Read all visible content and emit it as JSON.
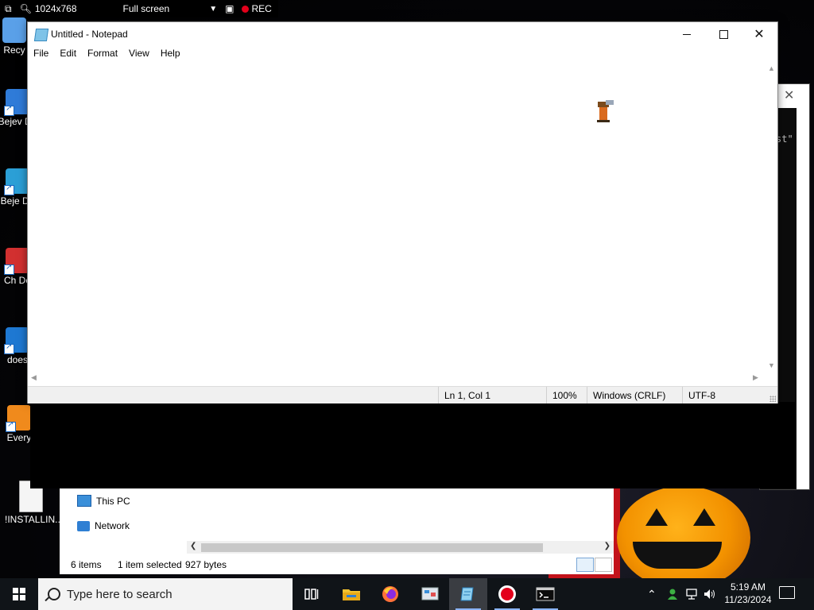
{
  "recorder": {
    "resolution": "1024x768",
    "mode": "Full screen",
    "rec_label": "REC",
    "rec_color": "#e3001b"
  },
  "desktop": {
    "icons": [
      {
        "label": "Recy",
        "name": "recycle-bin-icon",
        "color": "#5aa0e8"
      },
      {
        "label": "Bejev De",
        "name": "bejeweled-deluxe-icon",
        "color": "#2f7bd8"
      },
      {
        "label": "Beje De",
        "name": "bejeweled-icon",
        "color": "#2b9fd6"
      },
      {
        "label": "Ch De",
        "name": "chuzzle-deluxe-icon",
        "color": "#d23030"
      },
      {
        "label": "does",
        "name": "does-icon",
        "color": "#1e78d2"
      },
      {
        "label": "Every",
        "name": "everything-icon",
        "color": "#f08a1c"
      },
      {
        "label": "!INSTALLIN...",
        "name": "installing-file-icon",
        "color": "#f5f5f5"
      }
    ]
  },
  "notepad": {
    "title": "Untitled - Notepad",
    "menu": [
      "File",
      "Edit",
      "Format",
      "View",
      "Help"
    ],
    "content": "",
    "status": {
      "position": "Ln 1, Col 1",
      "zoom": "100%",
      "line_ending": "Windows (CRLF)",
      "encoding": "UTF-8"
    }
  },
  "console": {
    "text_fragment": "st\""
  },
  "explorer": {
    "nav": [
      "This PC",
      "Network"
    ],
    "status": {
      "items": "6 items",
      "selected": "1 item selected",
      "size": "927 bytes"
    }
  },
  "taskbar": {
    "search_placeholder": "Type here to search",
    "apps": [
      "task-view",
      "file-explorer",
      "firefox",
      "paint",
      "notepad",
      "recorder",
      "terminal"
    ],
    "time": "5:19 AM",
    "date": "11/23/2024"
  }
}
